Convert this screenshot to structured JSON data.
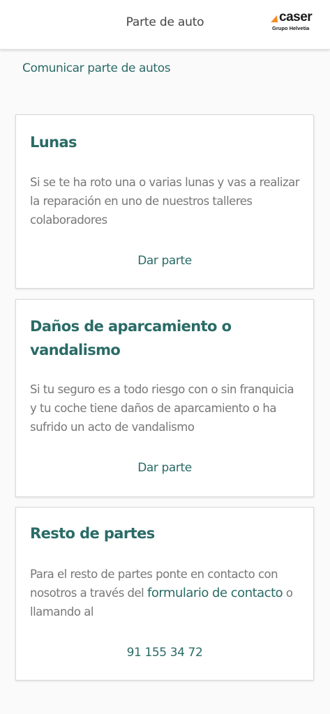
{
  "header": {
    "title": "Parte de auto",
    "logo": {
      "word": "caser",
      "subtitle": "Grupo Helvetia",
      "accent_color": "#f28c28"
    }
  },
  "main": {
    "section_link": "Comunicar parte de autos",
    "cards": [
      {
        "title": "Lunas",
        "description": "Si se te ha roto una o varias lunas y vas a realizar la reparación en uno de nuestros talleres colaboradores",
        "action": "Dar parte"
      },
      {
        "title": "Daños de aparcamiento o vandalismo",
        "description": "Si tu seguro es a todo riesgo con o sin franquicia y tu coche tiene daños de aparcamiento o ha sufrido un acto de vandalismo",
        "action": "Dar parte"
      },
      {
        "title": "Resto de partes",
        "description_before": "Para el resto de partes ponte en contacto con nosotros a través del ",
        "description_link": "formulario de contacto",
        "description_after": " o llamando al",
        "action": "91 155 34 72"
      }
    ]
  },
  "colors": {
    "brand_green": "#2a6b66",
    "text_gray": "#777777",
    "header_text": "#444444"
  }
}
